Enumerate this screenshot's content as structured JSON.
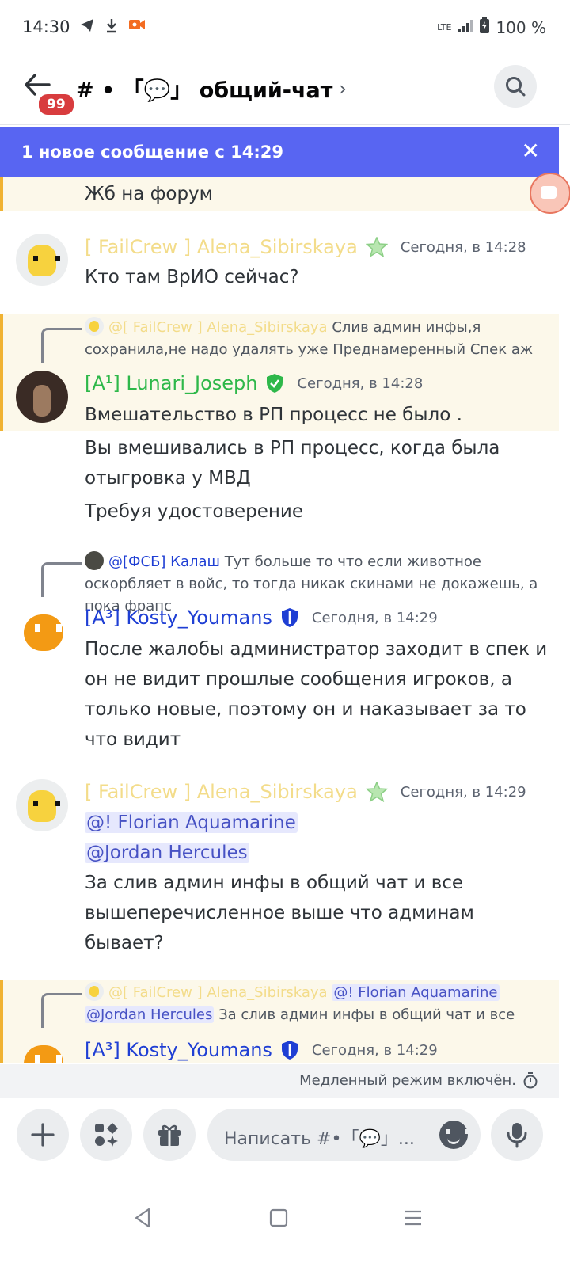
{
  "status_bar": {
    "time": "14:30",
    "notification_icons": [
      "telegram-icon",
      "download-icon",
      "camera-icon"
    ],
    "network": "LTE",
    "battery": "100 %"
  },
  "header": {
    "unread_badge": "99",
    "channel_name": "# • 「💬」 общий-чат",
    "chevron": "›"
  },
  "banner": {
    "text": "1 новое сообщение с 14:29",
    "close": "✕"
  },
  "messages": [
    {
      "type": "continuation",
      "text": "Жб на форум",
      "highlighted": true
    },
    {
      "author": "[ FailCrew ] Alena_Sibirskaya",
      "role_icon": "star-icon",
      "timestamp": "Сегодня, в 14:28",
      "lines": [
        "Кто там ВрИО сейчас?"
      ]
    },
    {
      "reply_to_author": "@[ FailCrew ] Alena_Sibirskaya",
      "reply_text": "Слив админ инфы,я сохранила,не надо удалять уже Преднамеренный Спек аж",
      "author": "[A¹] Lunari_Joseph",
      "role_icon": "shield-icon",
      "timestamp": "Сегодня, в 14:28",
      "lines": [
        "Вмешательство в РП процесс не было ."
      ],
      "highlighted": true
    },
    {
      "type": "continuation",
      "text": "Вы вмешивались в РП процесс, когда была отыгровка у МВД"
    },
    {
      "type": "continuation",
      "text": "Требуя удостоверение"
    },
    {
      "reply_to_author": "@[ФСБ] Калаш",
      "reply_text": "Тут больше то что если животное оскорбляет в войс, то тогда никак скинами не докажешь, а пока фрапс",
      "author": "[A³] Kosty_Youmans",
      "role_icon": "shield-icon",
      "timestamp": "Сегодня, в 14:29",
      "lines": [
        "После жалобы администратор заходит в спек и он не видит прошлые сообщения игроков, а только новые, поэтому он и наказывает за то что видит"
      ]
    },
    {
      "author": "[ FailCrew ] Alena_Sibirskaya",
      "role_icon": "star-icon",
      "timestamp": "Сегодня, в 14:29",
      "mentions": [
        "@! Florian Aquamarine",
        "@Jordan Hercules"
      ],
      "lines": [
        "За слив админ инфы в общий чат и все вышеперечисленное выше что админам бывает?"
      ]
    },
    {
      "reply_to_author": "@[ FailCrew ] Alena_Sibirskaya",
      "reply_mentions": [
        "@! Florian Aquamarine",
        "@Jordan Hercules"
      ],
      "reply_text": "За слив админ инфы в общий чат и все",
      "author": "[A³] Kosty_Youmans",
      "role_icon": "shield-icon",
      "timestamp": "Сегодня, в 14:29",
      "highlighted": true
    }
  ],
  "slow_mode": {
    "text": "Медленный режим включён.",
    "icon": "timer-icon"
  },
  "composer": {
    "placeholder": "Написать #•「💬」...",
    "buttons": [
      "plus-icon",
      "apps-icon",
      "gift-icon",
      "emoji-icon",
      "microphone-icon"
    ]
  },
  "navigation": [
    "back-triangle-icon",
    "home-square-icon",
    "menu-lines-icon"
  ],
  "colors": {
    "banner": "#5865f2",
    "highlight_bg": "#fcf8ea",
    "highlight_bar": "#f0b232",
    "failcrew_name": "#f3dc8a",
    "green_name": "#2eb84a",
    "blue_name": "#1f3fd4",
    "mention": "#4752c4",
    "badge": "#d83c3e"
  }
}
